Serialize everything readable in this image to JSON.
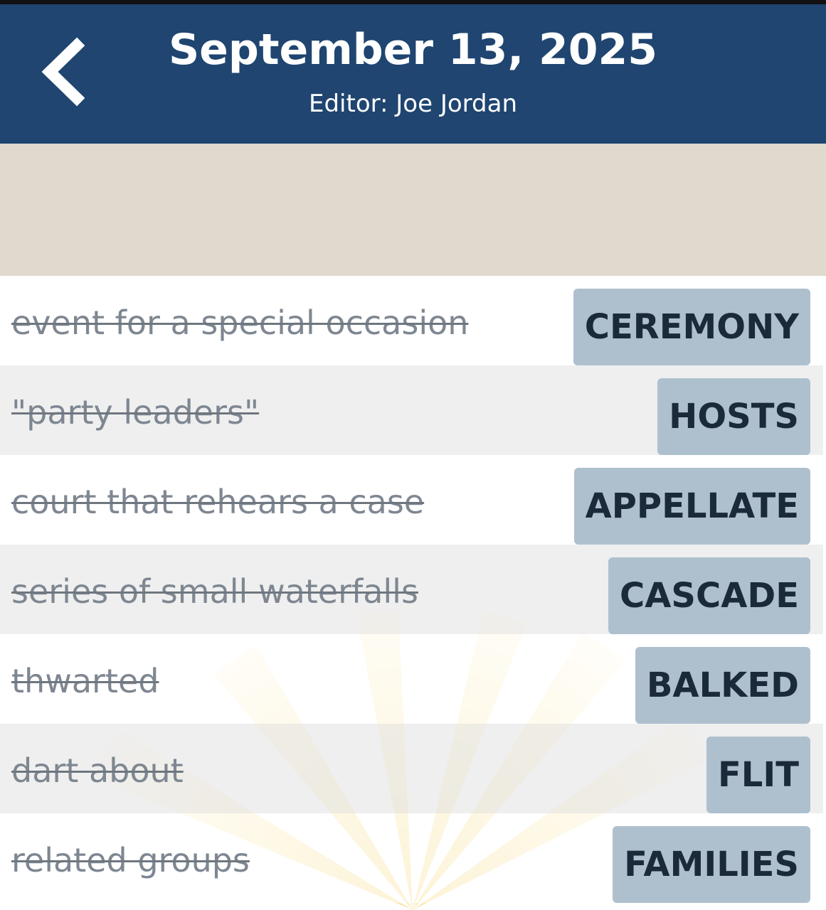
{
  "header": {
    "title": "September 13, 2025",
    "subtitle": "Editor: Joe Jordan",
    "back_icon": "chevron-left-icon",
    "background_color": "#1f4570"
  },
  "banner": {
    "background_color": "#e0d9cd"
  },
  "clues": [
    {
      "clue": "event for a special occasion",
      "answer": "CEREMONY"
    },
    {
      "clue": "\"party leaders\"",
      "answer": "HOSTS"
    },
    {
      "clue": "court that rehears a case",
      "answer": "APPELLATE"
    },
    {
      "clue": "series of small waterfalls",
      "answer": "CASCADE"
    },
    {
      "clue": "thwarted",
      "answer": "BALKED"
    },
    {
      "clue": "dart about",
      "answer": "FLIT"
    },
    {
      "clue": "related groups",
      "answer": "FAMILIES"
    }
  ],
  "colors": {
    "answer_tile": "#aec0ce",
    "answer_text": "#1b2a3a",
    "clue_text": "#7e8791",
    "sunburst": "#f7d774"
  }
}
